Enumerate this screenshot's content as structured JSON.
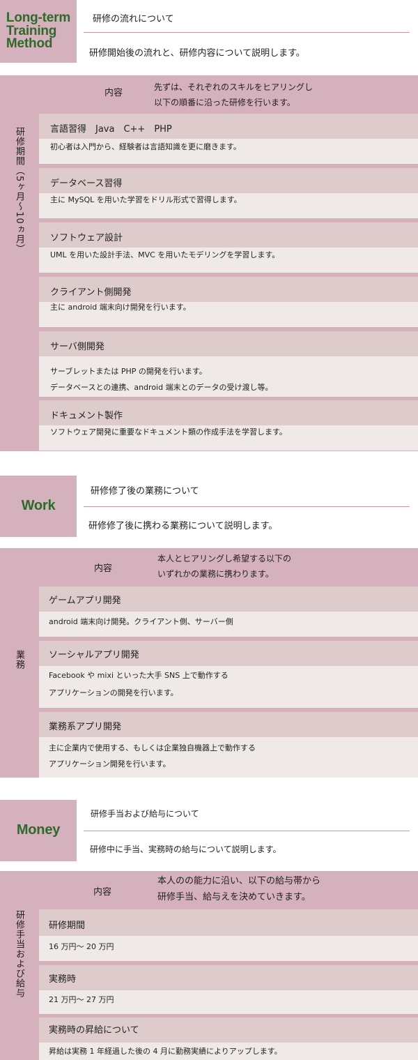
{
  "colors": {
    "accent": "#d5b0bd",
    "logo_text": "#2f6a2b",
    "item_header": "#ddcccb",
    "item_body": "#efe9e8",
    "rule": "#c89898"
  },
  "training": {
    "logo_line1": "Long-term",
    "logo_line2": "Training",
    "logo_line3": "Method",
    "title": "研修の流れについて",
    "subtitle": "研修開始後の流れと、研修内容について説明します。",
    "side_label": "研修期間（5ヶ月〜10ヵ月）",
    "head_label": "内容",
    "head_desc1": "先ずは、それぞれのスキルをヒアリングし",
    "head_desc2": "以下の順番に沿った研修を行います。",
    "items": [
      {
        "title": "言語習得　Java　C++　PHP",
        "body1": "初心者は入門から、経験者は言語知識を更に磨きます。"
      },
      {
        "title": "データベース習得",
        "body1": "主に MySQL を用いた学習をドリル形式で習得します。"
      },
      {
        "title": "ソフトウェア設計",
        "body1": "UML を用いた設計手法、MVC を用いたモデリングを学習します。"
      },
      {
        "title": "クライアント側開発",
        "body1": "主に android 端末向け開発を行います。"
      },
      {
        "title": "サーバ側開発",
        "body1": "サーブレットまたは PHP の開発を行います。",
        "body2": "データベースとの連携、android 端末とのデータの受け渡し等。"
      },
      {
        "title": "ドキュメント製作",
        "body1": "ソフトウェア開発に重要なドキュメント類の作成手法を学習します。"
      }
    ]
  },
  "work": {
    "logo": "Work",
    "title": "研修修了後の業務について",
    "subtitle": "研修修了後に携わる業務について説明します。",
    "side_label": "業務",
    "head_label": "内容",
    "head_desc1": "本人とヒアリングし希望する以下の",
    "head_desc2": "いずれかの業務に携わります。",
    "items": [
      {
        "title": "ゲームアプリ開発",
        "body1": "android 端末向け開発。クライアント側、サーバー側"
      },
      {
        "title": "ソーシャルアプリ開発",
        "body1": "Facebook や mixi といった大手 SNS 上で動作する",
        "body2": "アプリケーションの開発を行います。"
      },
      {
        "title": "業務系アプリ開発",
        "body1": "主に企業内で使用する、もしくは企業独自機器上で動作する",
        "body2": "アプリケーション開発を行います。"
      }
    ]
  },
  "money": {
    "logo": "Money",
    "title": "研修手当および給与について",
    "subtitle": "研修中に手当、実務時の給与について説明します。",
    "side_label": "研修手当および給与",
    "head_label": "内容",
    "head_desc1": "本人のの能力に沿い、以下の給与帯から",
    "head_desc2": "研修手当、給与えを決めていきます。",
    "items": [
      {
        "title": "研修期間",
        "body1": "16 万円〜 20 万円"
      },
      {
        "title": "実務時",
        "body1": "21 万円〜 27 万円"
      },
      {
        "title": "実務時の昇給について",
        "body1": "昇給は実務 1 年経過した後の 4 月に勤務実績によりアップします。"
      }
    ]
  }
}
